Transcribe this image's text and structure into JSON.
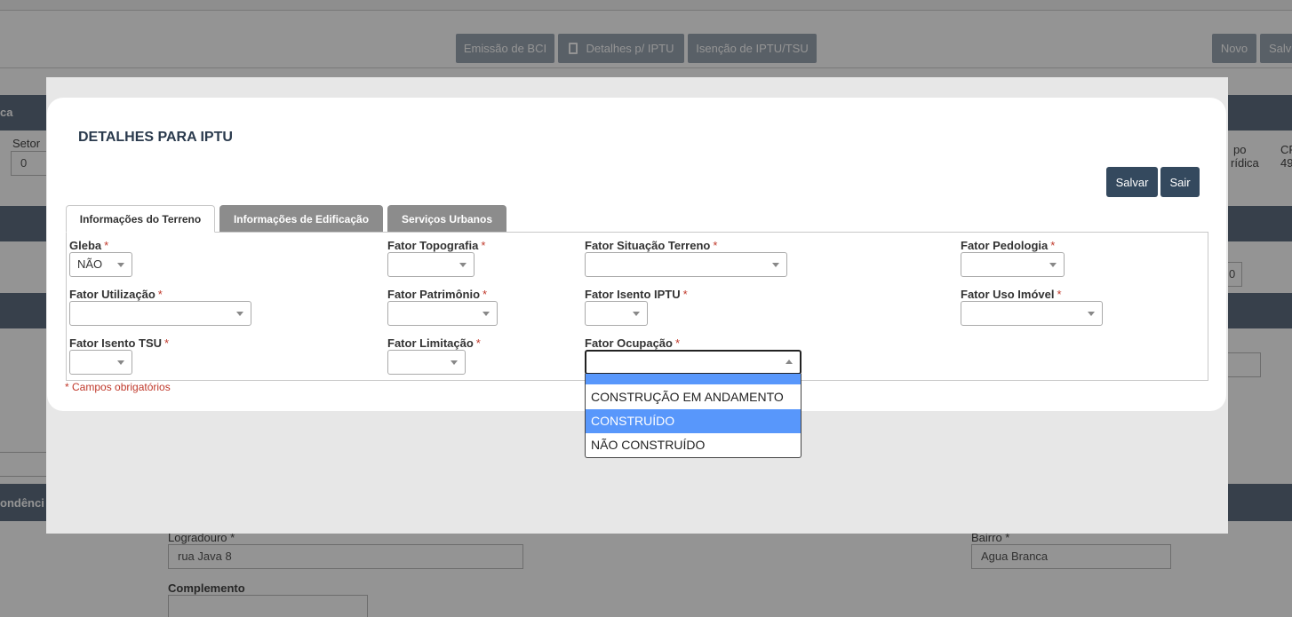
{
  "background": {
    "toolbar": {
      "emissao_bci": "Emissão de BCI",
      "detalhes_iptu": "Detalhes p/ IPTU",
      "isencao": "Isenção de IPTU/TSU",
      "novo": "Novo",
      "salvar": "Salv"
    },
    "band1_text": "ca",
    "band_correspondencia": "ondênci",
    "setor_label": "Setor",
    "setor_value": "0",
    "right_label_1": "po",
    "right_label_2": "rídica",
    "right_label_3": "CP",
    "right_value_3": "49",
    "right_small_input": "0",
    "logradouro_label": "Logradouro *",
    "logradouro_value": "rua Java 8",
    "bairro_label": "Bairro *",
    "bairro_value": "Agua Branca",
    "complemento_label": "Complemento"
  },
  "modal": {
    "title": "DETALHES PARA IPTU",
    "salvar": "Salvar",
    "sair": "Sair",
    "tabs": [
      {
        "label": "Informações do Terreno",
        "active": true
      },
      {
        "label": "Informações de Edificação",
        "active": false
      },
      {
        "label": "Serviços Urbanos",
        "active": false
      }
    ],
    "required_marker": "*",
    "fields": {
      "gleba": {
        "label": "Gleba",
        "value": "NÃO"
      },
      "fator_topografia": {
        "label": "Fator Topografia",
        "value": ""
      },
      "fator_situacao_terreno": {
        "label": "Fator Situação Terreno",
        "value": ""
      },
      "fator_pedologia": {
        "label": "Fator Pedologia",
        "value": ""
      },
      "fator_utilizacao": {
        "label": "Fator Utilização",
        "value": ""
      },
      "fator_patrimonio": {
        "label": "Fator Patrimônio",
        "value": ""
      },
      "fator_isento_iptu": {
        "label": "Fator Isento IPTU",
        "value": ""
      },
      "fator_uso_imovel": {
        "label": "Fator Uso Imóvel",
        "value": ""
      },
      "fator_isento_tsu": {
        "label": "Fator Isento TSU",
        "value": ""
      },
      "fator_limitacao": {
        "label": "Fator Limitação",
        "value": ""
      },
      "fator_ocupacao": {
        "label": "Fator Ocupação",
        "value": ""
      }
    },
    "required_note": "* Campos obrigatórios",
    "ocupacao_options": [
      "",
      "CONSTRUÇÃO EM ANDAMENTO",
      "CONSTRUÍDO",
      "NÃO CONSTRUÍDO"
    ],
    "ocupacao_highlighted": "CONSTRUÍDO"
  },
  "colors": {
    "modal_button": "#34495e",
    "tab_inactive": "#8c8c8c",
    "required": "#c0392b",
    "option_highlight": "#5897fb"
  }
}
